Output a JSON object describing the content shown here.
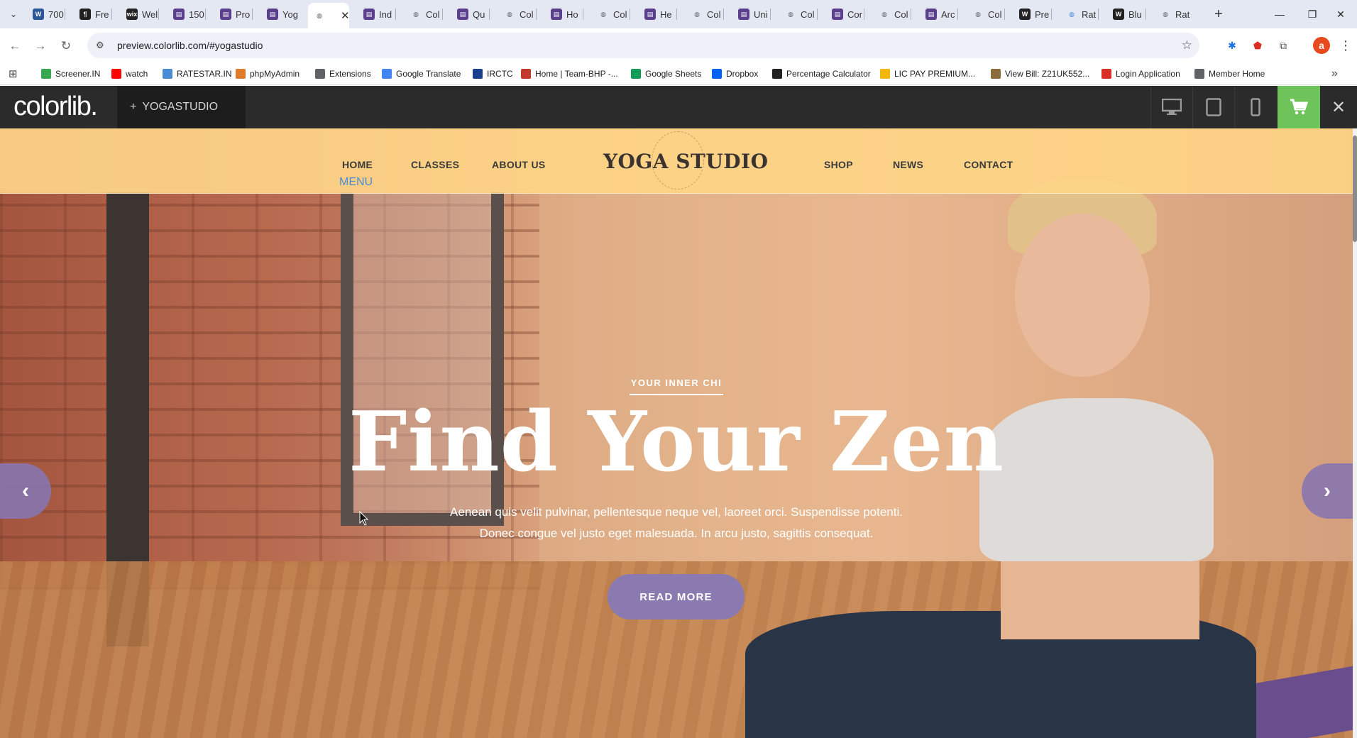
{
  "browser": {
    "tabs": [
      {
        "label": "700",
        "icon": "word-icon",
        "color": "#2b579a"
      },
      {
        "label": "Fre",
        "icon": "document-icon",
        "color": "#1f1f1f"
      },
      {
        "label": "Wel",
        "icon": "wix-icon",
        "color": "#222222"
      },
      {
        "label": "150",
        "icon": "colorlib-icon",
        "color": "#5b3f8c"
      },
      {
        "label": "Pro",
        "icon": "colorlib-icon",
        "color": "#5b3f8c"
      },
      {
        "label": "Yog",
        "icon": "colorlib-icon",
        "color": "#5b3f8c"
      },
      {
        "label": "",
        "icon": "globe-icon",
        "color": "#5f6368",
        "active": true
      },
      {
        "label": "Ind",
        "icon": "colorlib-icon",
        "color": "#5b3f8c"
      },
      {
        "label": "Col",
        "icon": "globe-icon",
        "color": "#5f6368"
      },
      {
        "label": "Qu",
        "icon": "colorlib-icon",
        "color": "#5b3f8c"
      },
      {
        "label": "Col",
        "icon": "globe-icon",
        "color": "#5f6368"
      },
      {
        "label": "Ho",
        "icon": "colorlib-icon",
        "color": "#5b3f8c"
      },
      {
        "label": "Col",
        "icon": "globe-icon",
        "color": "#5f6368"
      },
      {
        "label": "He",
        "icon": "colorlib-icon",
        "color": "#5b3f8c"
      },
      {
        "label": "Col",
        "icon": "globe-icon",
        "color": "#5f6368"
      },
      {
        "label": "Uni",
        "icon": "colorlib-icon",
        "color": "#5b3f8c"
      },
      {
        "label": "Col",
        "icon": "globe-icon",
        "color": "#5f6368"
      },
      {
        "label": "Cor",
        "icon": "colorlib-icon",
        "color": "#5b3f8c"
      },
      {
        "label": "Col",
        "icon": "globe-icon",
        "color": "#5f6368"
      },
      {
        "label": "Arc",
        "icon": "colorlib-icon",
        "color": "#5b3f8c"
      },
      {
        "label": "Col",
        "icon": "globe-icon",
        "color": "#5f6368"
      },
      {
        "label": "Pre",
        "icon": "wikipedia-icon",
        "color": "#222222"
      },
      {
        "label": "Rat",
        "icon": "globe-icon",
        "color": "#4a8bd8"
      },
      {
        "label": "Blu",
        "icon": "wikipedia-icon",
        "color": "#222222"
      },
      {
        "label": "Rat",
        "icon": "globe-icon",
        "color": "#5f6368"
      }
    ],
    "new_tab_label": "+",
    "url": "preview.colorlib.com/#yogastudio",
    "bookmarks": [
      {
        "label": "Screener.IN",
        "color": "#36a852"
      },
      {
        "label": "watch",
        "color": "#ff0000"
      },
      {
        "label": "RATESTAR.IN",
        "color": "#4a8bd8"
      },
      {
        "label": "phpMyAdmin",
        "color": "#e07b2c"
      },
      {
        "label": "Extensions",
        "color": "#5f6368"
      },
      {
        "label": "Google Translate",
        "color": "#4285f4"
      },
      {
        "label": "IRCTC",
        "color": "#1a3f8c"
      },
      {
        "label": "Home | Team-BHP -...",
        "color": "#c0392b"
      },
      {
        "label": "Google Sheets",
        "color": "#0f9d58"
      },
      {
        "label": "Dropbox",
        "color": "#0061ff"
      },
      {
        "label": "Percentage Calculator",
        "color": "#222222"
      },
      {
        "label": "LIC PAY PREMIUM...",
        "color": "#f2b705"
      },
      {
        "label": "View Bill: Z21UK552...",
        "color": "#8a6d3b"
      },
      {
        "label": "Login Application",
        "color": "#d93025"
      },
      {
        "label": "Member Home",
        "color": "#5f6368"
      }
    ],
    "profile_initial": "a",
    "profile_color": "#e8491d"
  },
  "demo_bar": {
    "logo": "colorlib.",
    "theme_plus": "+",
    "theme_name": "YOGASTUDIO",
    "cart_color": "#6ec35b"
  },
  "site": {
    "nav_left": [
      "HOME",
      "CLASSES",
      "ABOUT US"
    ],
    "logo": "YOGA STUDIO",
    "nav_right": [
      "SHOP",
      "NEWS",
      "CONTACT"
    ],
    "menu_label": "MENU",
    "hero": {
      "eyebrow": "YOUR INNER CHI",
      "headline": "Find Your Zen",
      "sub_line1": "Aenean quis velit pulvinar, pellentesque neque vel, laoreet orci. Suspendisse potenti.",
      "sub_line2": "Donec congue vel justo eget malesuada. In arcu justo, sagittis consequat.",
      "cta": "READ MORE",
      "prev_arrow": "‹",
      "next_arrow": "›"
    },
    "accent_color": "#8a7ab0",
    "header_color": "#ffd686"
  }
}
